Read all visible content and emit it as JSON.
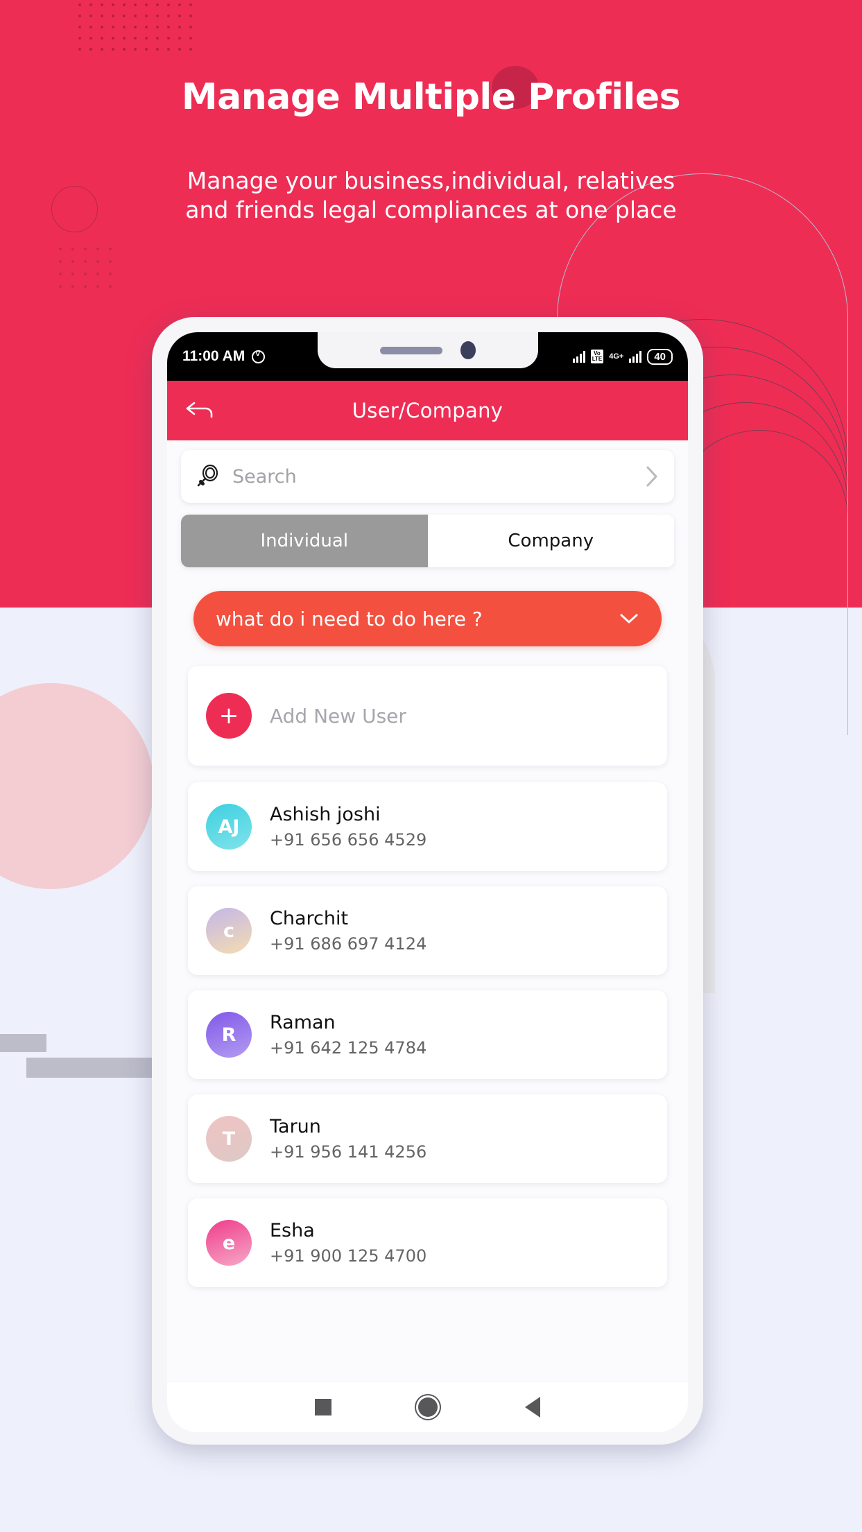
{
  "promo": {
    "headline": "Manage Multiple Profiles",
    "subline_1": "Manage your business,individual, relatives",
    "subline_2": "and friends legal compliances at one place",
    "brand_color": "#ee2d55",
    "background_color": "#eef0fb"
  },
  "status_bar": {
    "time": "11:00 AM",
    "alarm_icon": "alarm-icon",
    "signal_icon": "signal-bars-icon",
    "volte_label_top": "Vo",
    "volte_label_bottom": "LTE",
    "network": "4G+",
    "battery": "40"
  },
  "app_bar": {
    "back_icon": "back-arrow-icon",
    "title": "User/Company"
  },
  "search": {
    "icon": "search-icon",
    "placeholder": "Search",
    "chevron_icon": "chevron-right-icon"
  },
  "tabs": [
    {
      "label": "Individual",
      "active": true
    },
    {
      "label": "Company",
      "active": false
    }
  ],
  "dropdown": {
    "label": "what do i need to do here ?",
    "chevron_icon": "chevron-down-icon",
    "color": "#f4503f"
  },
  "add_row": {
    "icon": "plus-icon",
    "label": "Add New User"
  },
  "contacts": [
    {
      "initials": "AJ",
      "name": "Ashish joshi",
      "phone": "+91 656 656 4529",
      "avatar_from": "#3fd0e0",
      "avatar_to": "#7fe3ea"
    },
    {
      "initials": "c",
      "name": "Charchit",
      "phone": "+91 686 697 4124",
      "avatar_from": "#c4b7e8",
      "avatar_to": "#f4dcb0"
    },
    {
      "initials": "R",
      "name": "Raman",
      "phone": "+91 642 125 4784",
      "avatar_from": "#8159e8",
      "avatar_to": "#b39bf2"
    },
    {
      "initials": "T",
      "name": "Tarun",
      "phone": "+91 956 141 4256",
      "avatar_from": "#f0c3c3",
      "avatar_to": "#ddc9c6"
    },
    {
      "initials": "e",
      "name": "Esha",
      "phone": "+91 900 125 4700",
      "avatar_from": "#ef3d8a",
      "avatar_to": "#f6a8c8"
    }
  ],
  "nav_bar": {
    "recents_icon": "square-recents-icon",
    "home_icon": "circle-home-icon",
    "back_icon": "triangle-back-icon"
  }
}
